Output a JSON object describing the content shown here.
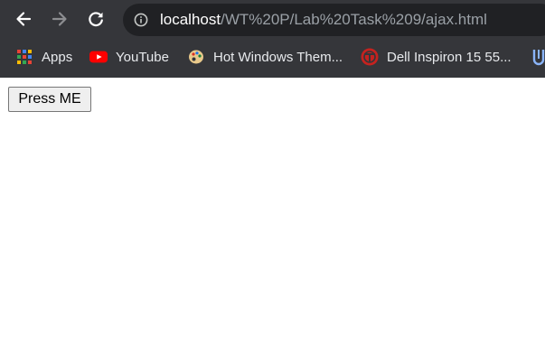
{
  "toolbar": {
    "back_icon": "back-arrow-icon",
    "forward_icon": "forward-arrow-icon",
    "reload_icon": "reload-icon"
  },
  "address_bar": {
    "info_icon": "info-icon",
    "host": "localhost",
    "path": "/WT%20P/Lab%20Task%209/ajax.html"
  },
  "bookmarks": [
    {
      "label": "Apps",
      "icon": "apps-grid-icon"
    },
    {
      "label": "YouTube",
      "icon": "youtube-icon"
    },
    {
      "label": "Hot Windows Them...",
      "icon": "palette-icon"
    },
    {
      "label": "Dell Inspiron 15 55...",
      "icon": "dell-site-icon"
    },
    {
      "label": "",
      "icon": "partial-bookmark-icon"
    }
  ],
  "page": {
    "button_label": "Press ME"
  },
  "colors": {
    "chrome_bg": "#35363a",
    "omnibox_bg": "#202124",
    "url_host": "#ffffff",
    "url_path": "#9aa0a6",
    "youtube_red": "#ff0000",
    "dell_red": "#c5221f"
  }
}
